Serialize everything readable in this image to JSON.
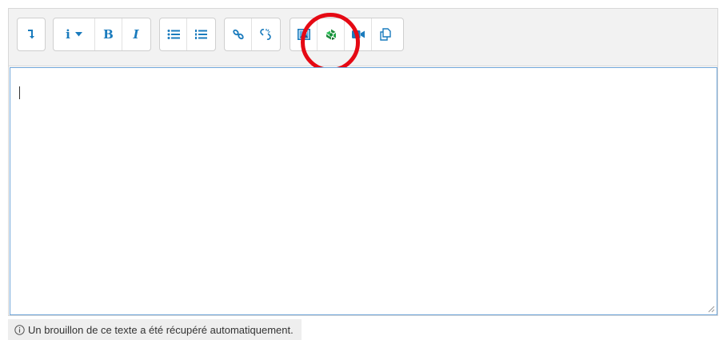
{
  "toolbar": {
    "toggle_icon": "toggle-toolbar-icon",
    "style_label": "i",
    "bold_label": "B",
    "italic_label": "I",
    "highlight_color": "#e50914",
    "icon_color": "#1a7bbd"
  },
  "editor": {
    "content": "",
    "border_color": "#6fa5d8"
  },
  "draft_notice": {
    "text": "Un brouillon de ce texte a été récupéré automatiquement."
  }
}
